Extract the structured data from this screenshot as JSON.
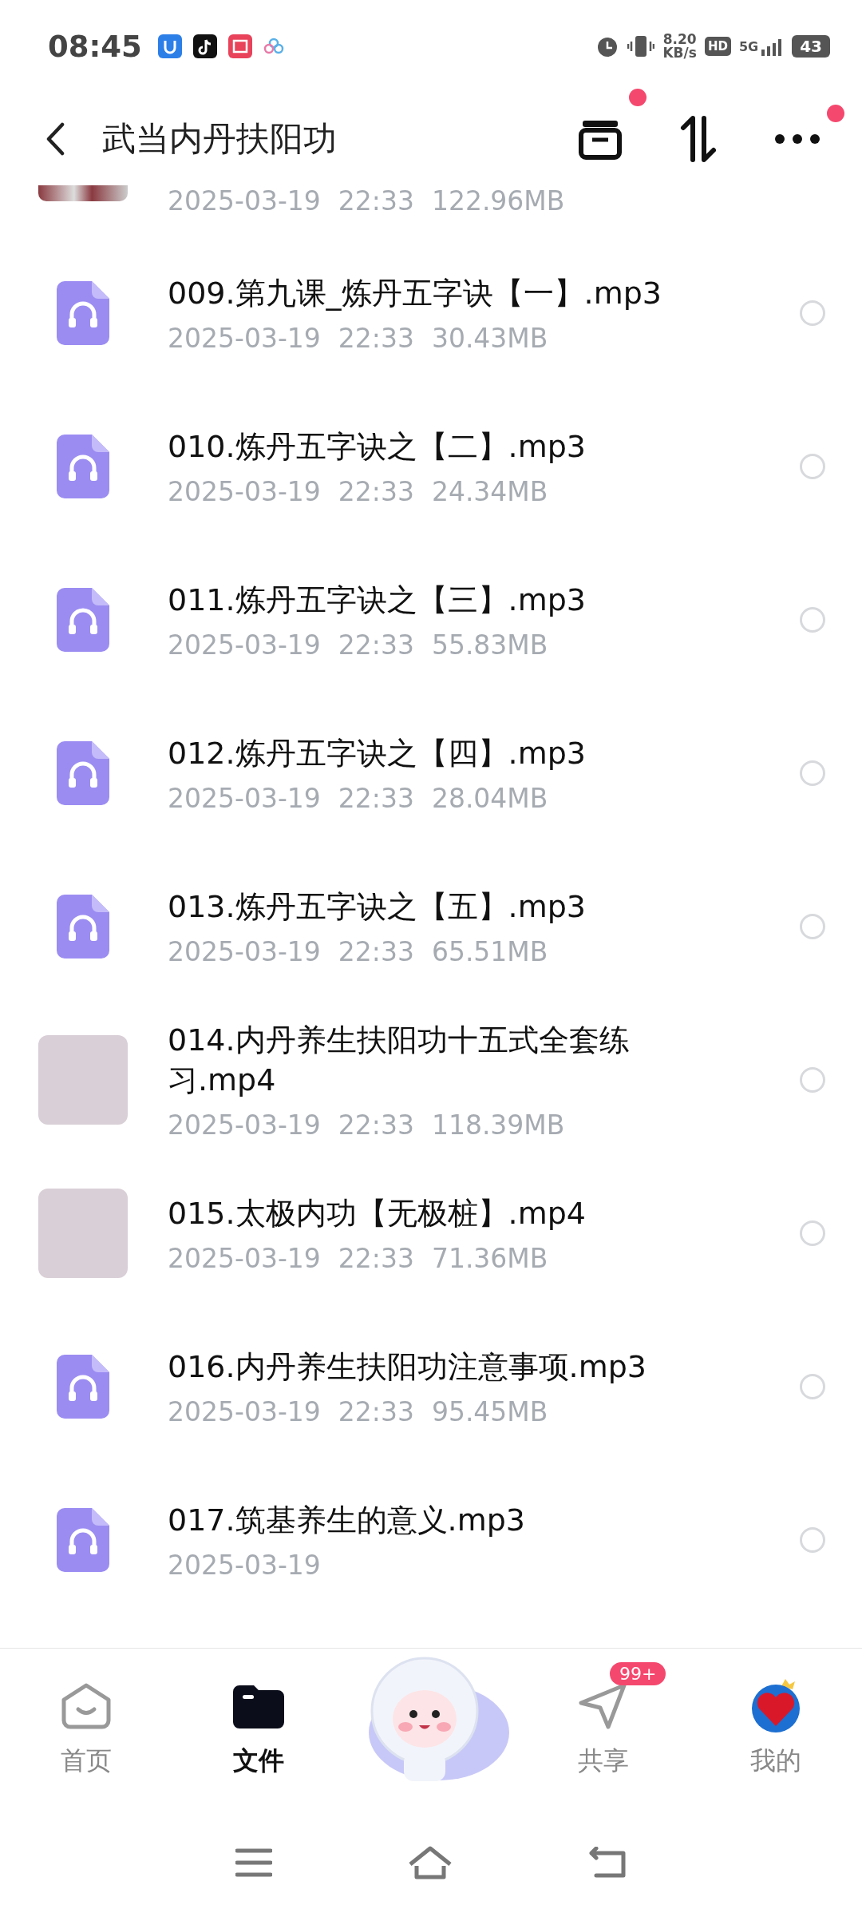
{
  "status_bar": {
    "time": "08:45",
    "net_speed": "8.20",
    "net_unit": "KB/s",
    "hd": "HD",
    "network": "5G",
    "battery": "43"
  },
  "header": {
    "title": "武当内丹扶阳功",
    "actions": [
      {
        "kind": "archive",
        "badge": true
      },
      {
        "kind": "sort"
      },
      {
        "kind": "more",
        "badge": true
      }
    ]
  },
  "files": [
    {
      "kind": "video",
      "date": "2025-03-19",
      "time": "22:33",
      "size": "122.96MB"
    },
    {
      "kind": "audio",
      "name": "009.第九课_炼丹五字诀【一】.mp3",
      "date": "2025-03-19",
      "time": "22:33",
      "size": "30.43MB",
      "selected": false
    },
    {
      "kind": "audio",
      "name": "010.炼丹五字诀之【二】.mp3",
      "date": "2025-03-19",
      "time": "22:33",
      "size": "24.34MB",
      "selected": false
    },
    {
      "kind": "audio",
      "name": "011.炼丹五字诀之【三】.mp3",
      "date": "2025-03-19",
      "time": "22:33",
      "size": "55.83MB",
      "selected": false
    },
    {
      "kind": "audio",
      "name": "012.炼丹五字诀之【四】.mp3",
      "date": "2025-03-19",
      "time": "22:33",
      "size": "28.04MB",
      "selected": false
    },
    {
      "kind": "audio",
      "name": "013.炼丹五字诀之【五】.mp3",
      "date": "2025-03-19",
      "time": "22:33",
      "size": "65.51MB",
      "selected": false
    },
    {
      "kind": "video",
      "name": "014.内丹养生扶阳功十五式全套练习.mp4",
      "date": "2025-03-19",
      "time": "22:33",
      "size": "118.39MB",
      "selected": false
    },
    {
      "kind": "video",
      "name": "015.太极内功【无极桩】.mp4",
      "date": "2025-03-19",
      "time": "22:33",
      "size": "71.36MB",
      "selected": false
    },
    {
      "kind": "audio",
      "name": "016.内丹养生扶阳功注意事项.mp3",
      "date": "2025-03-19",
      "time": "22:33",
      "size": "95.45MB",
      "selected": false
    },
    {
      "kind": "audio",
      "name": "017.筑基养生的意义.mp3",
      "date": "2025-03-19",
      "selected": false
    }
  ],
  "nav": [
    {
      "kind": "home",
      "label": "首页",
      "selected": false
    },
    {
      "kind": "files",
      "label": "文件",
      "selected": true
    },
    {
      "kind": "mascot"
    },
    {
      "kind": "share",
      "label": "共享",
      "selected": false,
      "badge": "99+"
    },
    {
      "kind": "profile",
      "label": "我的",
      "selected": false
    }
  ]
}
